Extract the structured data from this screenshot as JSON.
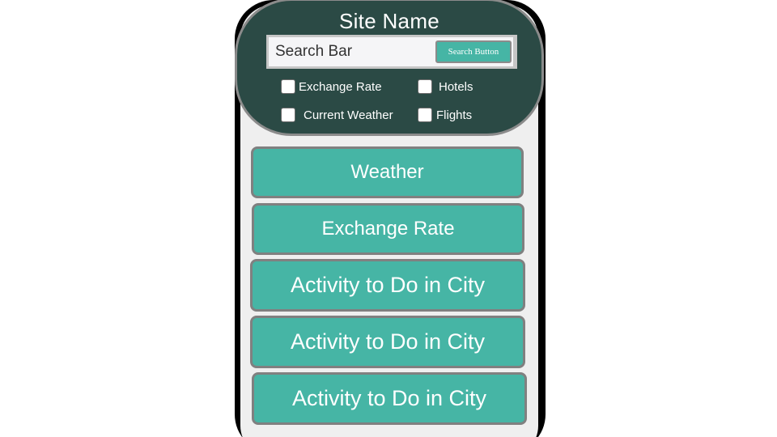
{
  "header": {
    "site_name": "Site Name",
    "search": {
      "placeholder": "Search Bar",
      "button_label": "Search Button"
    },
    "filters": [
      {
        "label": "Exchange Rate",
        "checked": false
      },
      {
        "label": "Hotels",
        "checked": false
      },
      {
        "label": "Current Weather",
        "checked": false
      },
      {
        "label": "Flights",
        "checked": false
      }
    ]
  },
  "tiles": [
    {
      "label": "Weather"
    },
    {
      "label": "Exchange Rate"
    },
    {
      "label": "Activity to Do in City"
    },
    {
      "label": "Activity to Do in City"
    },
    {
      "label": "Activity to Do in City"
    }
  ],
  "colors": {
    "header_bg": "#2b4a45",
    "accent": "#46b5a5",
    "frame": "#000000",
    "screen_bg": "#efefef"
  }
}
